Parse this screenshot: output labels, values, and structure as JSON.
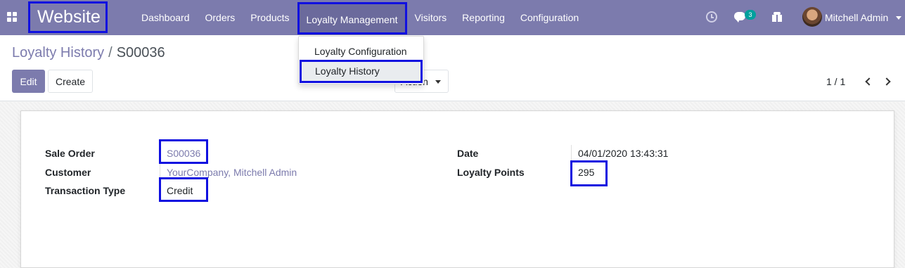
{
  "navbar": {
    "app_name": "Website",
    "menu": [
      "Dashboard",
      "Orders",
      "Products",
      "Loyalty Management",
      "Visitors",
      "Reporting",
      "Configuration"
    ],
    "chat_count": "3",
    "user_name": "Mitchell Admin"
  },
  "dropdown": {
    "items": [
      "Loyalty Configuration",
      "Loyalty History"
    ]
  },
  "breadcrumb": {
    "parent": "Loyalty History",
    "separator": "/",
    "current": "S00036"
  },
  "buttons": {
    "edit": "Edit",
    "create": "Create",
    "action": "Action"
  },
  "pager": {
    "value": "1 / 1"
  },
  "form": {
    "sale_order_label": "Sale Order",
    "sale_order_value": "S00036",
    "customer_label": "Customer",
    "customer_value": "YourCompany, Mitchell Admin",
    "transaction_type_label": "Transaction Type",
    "transaction_type_value": "Credit",
    "date_label": "Date",
    "date_value": "04/01/2020 13:43:31",
    "loyalty_points_label": "Loyalty Points",
    "loyalty_points_value": "295"
  },
  "colors": {
    "brand": "#7c7bad",
    "highlight": "#1010e0",
    "badge": "#00a09d"
  }
}
